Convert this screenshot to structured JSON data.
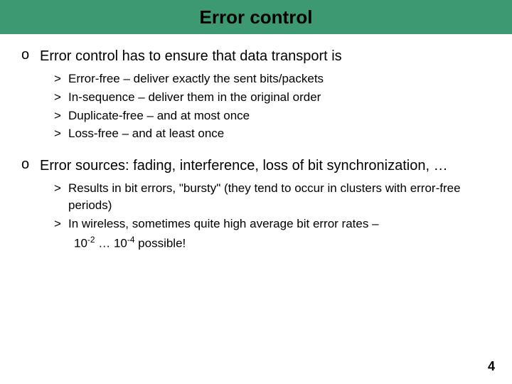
{
  "title": "Error control",
  "bullets": {
    "main": "o",
    "sub": ">"
  },
  "section1": {
    "text": "Error control has to ensure that data transport is",
    "items": [
      "Error-free – deliver exactly the sent bits/packets",
      "In-sequence – deliver them in the original order",
      "Duplicate-free – and at most once",
      "Loss-free – and at least once"
    ]
  },
  "section2": {
    "text": "Error sources: fading, interference, loss of bit synchronization, …",
    "items": [
      "Results in bit errors, \"bursty\" (they tend to occur in clusters with error-free periods)",
      "In wireless, sometimes quite high average bit error rates –"
    ],
    "tail_html": "10<sup>-2</sup> … 10<sup>-4</sup> possible!"
  },
  "page_number": "4"
}
